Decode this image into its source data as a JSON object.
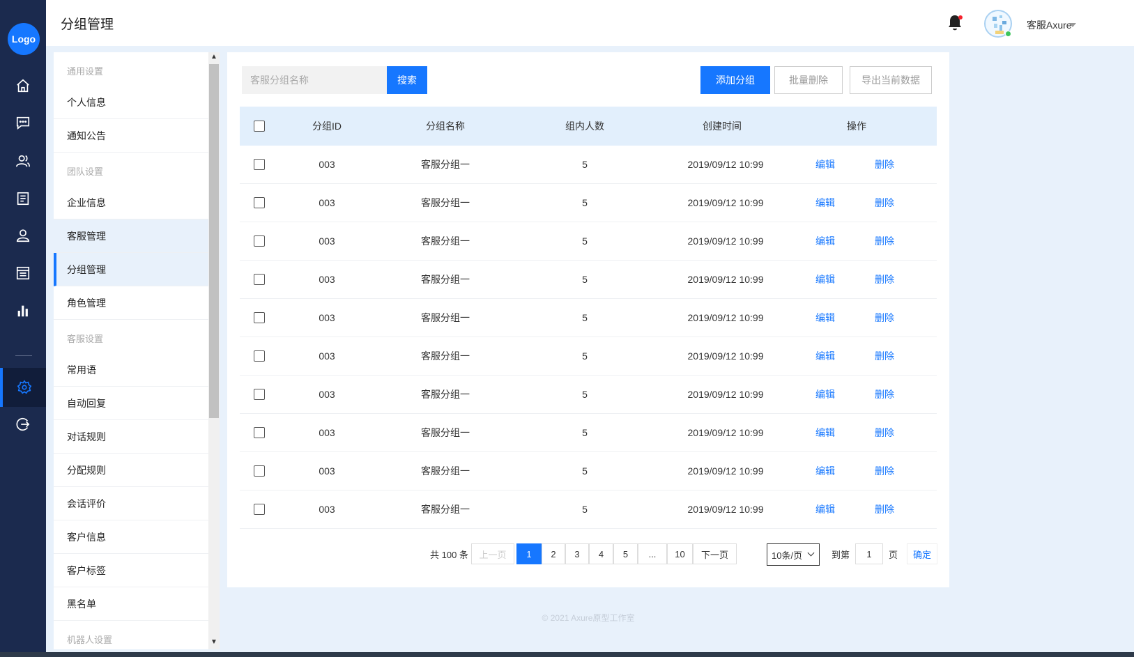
{
  "app": {
    "logo": "Logo",
    "page_title": "分组管理"
  },
  "rail": [
    "home-icon",
    "message-icon",
    "users-icon",
    "document-icon",
    "user-icon",
    "list-icon",
    "chart-icon",
    "settings-icon",
    "logout-icon"
  ],
  "header": {
    "user_name": "客服Axure"
  },
  "sidebar": {
    "group_general": "通用设置",
    "item_profile": "个人信息",
    "item_notice": "通知公告",
    "group_team": "团队设置",
    "item_company": "企业信息",
    "item_agents": "客服管理",
    "item_groups": "分组管理",
    "item_roles": "角色管理",
    "group_service": "客服设置",
    "item_phrases": "常用语",
    "item_autoreply": "自动回复",
    "item_dialog_rules": "对话规则",
    "item_assign_rules": "分配规则",
    "item_rating": "会话评价",
    "item_customer_info": "客户信息",
    "item_customer_tags": "客户标签",
    "item_blacklist": "黑名单",
    "group_robot": "机器人设置"
  },
  "toolbar": {
    "search_placeholder": "客服分组名称",
    "search_label": "搜索",
    "add_label": "添加分组",
    "batch_delete_label": "批量删除",
    "export_label": "导出当前数据"
  },
  "table": {
    "headers": {
      "id": "分组ID",
      "name": "分组名称",
      "count": "组内人数",
      "created": "创建时间",
      "actions": "操作"
    },
    "edit_label": "编辑",
    "delete_label": "删除",
    "rows": [
      {
        "id": "003",
        "name": "客服分组一",
        "count": "5",
        "created": "2019/09/12 10:99"
      },
      {
        "id": "003",
        "name": "客服分组一",
        "count": "5",
        "created": "2019/09/12 10:99"
      },
      {
        "id": "003",
        "name": "客服分组一",
        "count": "5",
        "created": "2019/09/12 10:99"
      },
      {
        "id": "003",
        "name": "客服分组一",
        "count": "5",
        "created": "2019/09/12 10:99"
      },
      {
        "id": "003",
        "name": "客服分组一",
        "count": "5",
        "created": "2019/09/12 10:99"
      },
      {
        "id": "003",
        "name": "客服分组一",
        "count": "5",
        "created": "2019/09/12 10:99"
      },
      {
        "id": "003",
        "name": "客服分组一",
        "count": "5",
        "created": "2019/09/12 10:99"
      },
      {
        "id": "003",
        "name": "客服分组一",
        "count": "5",
        "created": "2019/09/12 10:99"
      },
      {
        "id": "003",
        "name": "客服分组一",
        "count": "5",
        "created": "2019/09/12 10:99"
      },
      {
        "id": "003",
        "name": "客服分组一",
        "count": "5",
        "created": "2019/09/12 10:99"
      }
    ]
  },
  "pagination": {
    "total": "共 100 条",
    "prev": "上一页",
    "pages": [
      "1",
      "2",
      "3",
      "4",
      "5",
      "...",
      "10"
    ],
    "next": "下一页",
    "page_size": "10条/页",
    "goto_label": "到第",
    "goto_value": "1",
    "page_unit": "页",
    "confirm": "确定"
  },
  "footer": "© 2021   Axure原型工作室",
  "colors": {
    "primary": "#1677ff",
    "rail": "#1b2a4e",
    "background": "#e8f1fb",
    "header_row": "#e2effc"
  }
}
